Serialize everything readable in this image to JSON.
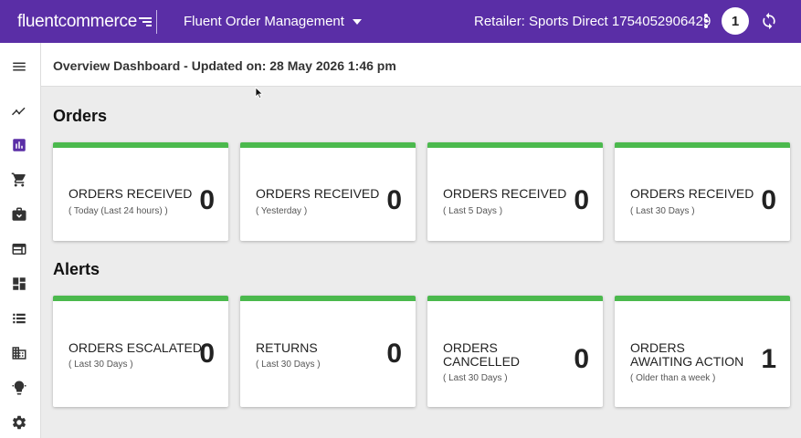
{
  "topbar": {
    "logo": "fluentcommerce",
    "app_title": "Fluent Order Management",
    "retailer": "Retailer: Sports Direct 1754052906429",
    "notification_count": "1",
    "color": "#5a2ea6"
  },
  "sidebar": {
    "items": [
      {
        "icon": "menu-icon"
      },
      {
        "icon": "trending-icon"
      },
      {
        "icon": "chart-icon",
        "active": true
      },
      {
        "icon": "cart-icon"
      },
      {
        "icon": "briefcase-icon"
      },
      {
        "icon": "web-icon"
      },
      {
        "icon": "dashboard-icon"
      },
      {
        "icon": "list-icon"
      },
      {
        "icon": "building-icon"
      },
      {
        "icon": "lightbulb-icon"
      },
      {
        "icon": "gear-icon"
      }
    ]
  },
  "page": {
    "title": "Overview Dashboard - Updated on: 28 May 2026 1:46 pm"
  },
  "orders": {
    "title": "Orders",
    "cards": [
      {
        "label": "ORDERS RECEIVED",
        "sub": "( Today (Last 24 hours) )",
        "value": "0"
      },
      {
        "label": "ORDERS RECEIVED",
        "sub": "( Yesterday )",
        "value": "0"
      },
      {
        "label": "ORDERS RECEIVED",
        "sub": "( Last 5 Days )",
        "value": "0"
      },
      {
        "label": "ORDERS RECEIVED",
        "sub": "( Last 30 Days )",
        "value": "0"
      }
    ]
  },
  "alerts": {
    "title": "Alerts",
    "cards": [
      {
        "label": "ORDERS ESCALATED",
        "sub": "( Last 30 Days )",
        "value": "0"
      },
      {
        "label": "RETURNS",
        "sub": "( Last 30 Days )",
        "value": "0"
      },
      {
        "label": "ORDERS CANCELLED",
        "sub": "( Last 30 Days )",
        "value": "0"
      },
      {
        "label": "ORDERS AWAITING ACTION",
        "sub": "( Older than a week )",
        "value": "1"
      }
    ]
  },
  "colors": {
    "accent": "#4bb94d",
    "active_icon": "#5a2ea6"
  }
}
